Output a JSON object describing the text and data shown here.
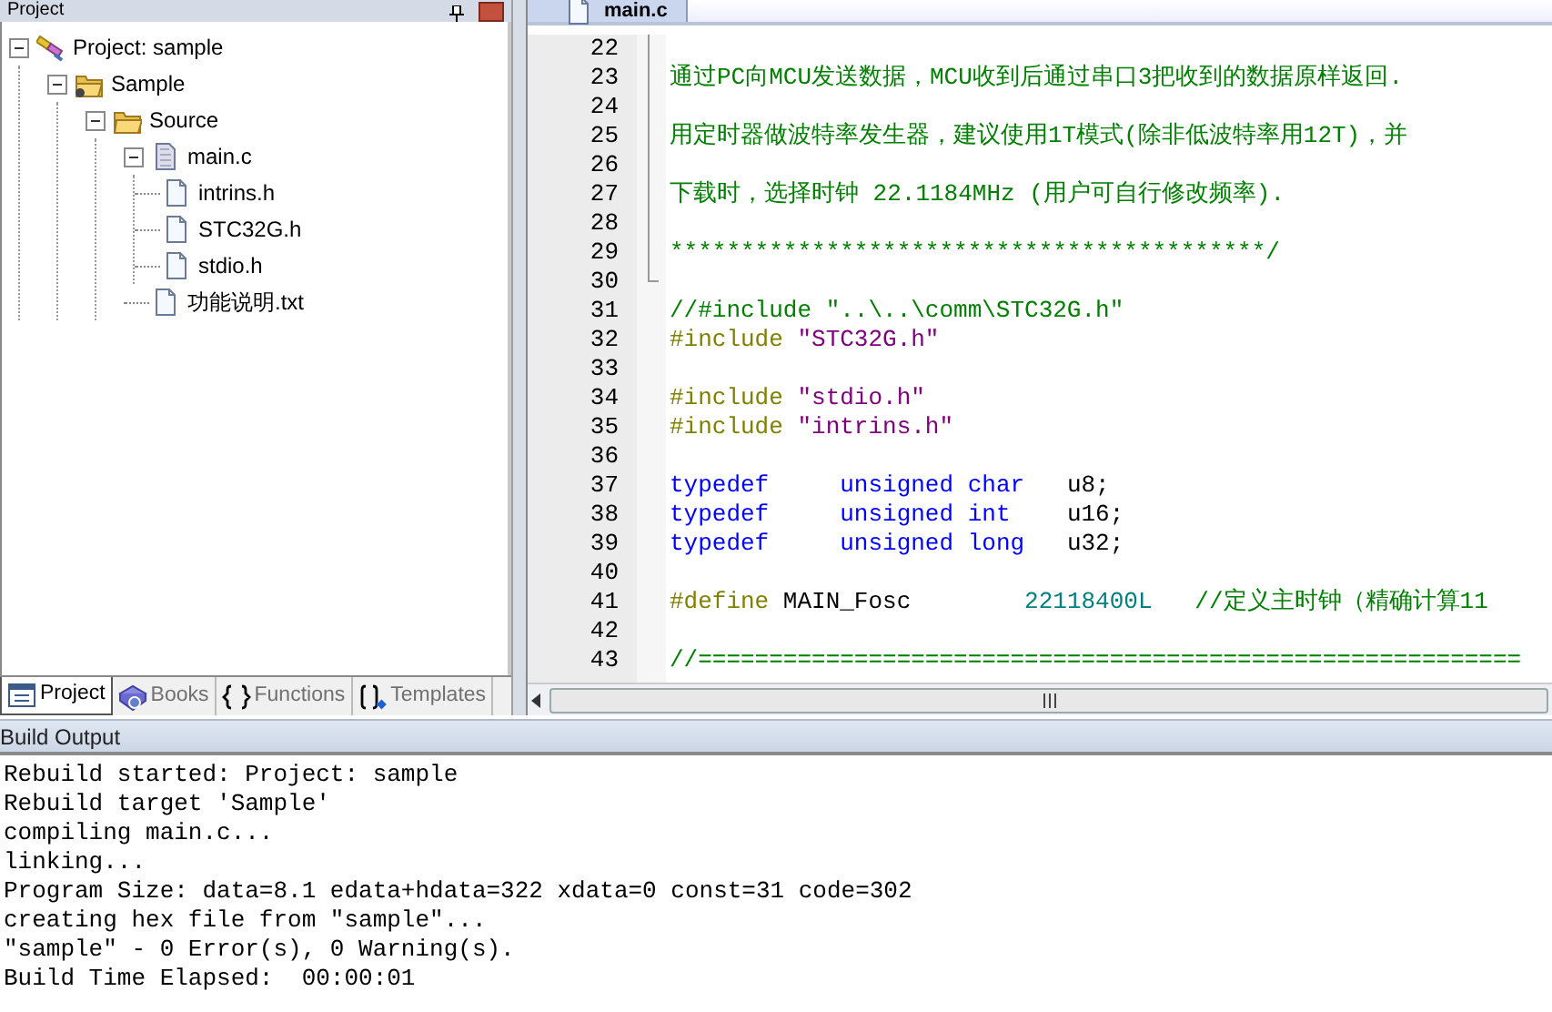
{
  "project_panel": {
    "title": "Project",
    "tree": [
      {
        "label": "Project: sample",
        "kind": "project",
        "expanded": true,
        "children": [
          {
            "label": "Sample",
            "kind": "target",
            "expanded": true,
            "children": [
              {
                "label": "Source",
                "kind": "folder",
                "expanded": true,
                "children": [
                  {
                    "label": "main.c",
                    "kind": "source",
                    "expanded": true,
                    "children": [
                      {
                        "label": "intrins.h",
                        "kind": "file"
                      },
                      {
                        "label": "STC32G.h",
                        "kind": "file"
                      },
                      {
                        "label": "stdio.h",
                        "kind": "file"
                      }
                    ]
                  },
                  {
                    "label": "功能说明.txt",
                    "kind": "file"
                  }
                ]
              }
            ]
          }
        ]
      }
    ],
    "tabs": [
      {
        "label": "Project",
        "kind": "project",
        "selected": true
      },
      {
        "label": "Books",
        "kind": "books",
        "selected": false
      },
      {
        "label": "Functions",
        "kind": "functions",
        "selected": false
      },
      {
        "label": "Templates",
        "kind": "templates",
        "selected": false
      }
    ]
  },
  "editor": {
    "tabs": [
      {
        "label": "main.c",
        "selected": true
      }
    ],
    "lines": [
      {
        "number": "22"
      },
      {
        "number": "23",
        "tokens": [
          {
            "text": "通过PC向MCU发送数据，MCU收到后通过串口3把收到的数据原样返回.",
            "kind": "comment"
          }
        ]
      },
      {
        "number": "24"
      },
      {
        "number": "25",
        "tokens": [
          {
            "text": "用定时器做波特率发生器，建议使用1T模式(除非低波特率用12T)，并",
            "kind": "comment"
          }
        ]
      },
      {
        "number": "26"
      },
      {
        "number": "27",
        "tokens": [
          {
            "text": "下载时，选择时钟 22.1184MHz (用户可自行修改频率).",
            "kind": "comment"
          }
        ]
      },
      {
        "number": "28"
      },
      {
        "number": "29",
        "tokens": [
          {
            "text": "******************************************/",
            "kind": "comment"
          }
        ]
      },
      {
        "number": "30"
      },
      {
        "number": "31",
        "tokens": [
          {
            "text": "//#include \"..\\..\\comm\\STC32G.h\"",
            "kind": "comment"
          }
        ]
      },
      {
        "number": "32",
        "tokens": [
          {
            "text": "#include ",
            "kind": "preproc"
          },
          {
            "text": "\"STC32G.h\"",
            "kind": "string"
          }
        ]
      },
      {
        "number": "33"
      },
      {
        "number": "34",
        "tokens": [
          {
            "text": "#include ",
            "kind": "preproc"
          },
          {
            "text": "\"stdio.h\"",
            "kind": "string"
          }
        ]
      },
      {
        "number": "35",
        "tokens": [
          {
            "text": "#include ",
            "kind": "preproc"
          },
          {
            "text": "\"intrins.h\"",
            "kind": "string"
          }
        ]
      },
      {
        "number": "36"
      },
      {
        "number": "37",
        "tokens": [
          {
            "text": "typedef     ",
            "kind": "keyword"
          },
          {
            "text": "unsigned char",
            "kind": "keyword"
          },
          {
            "text": "   u8;",
            "kind": "plain"
          }
        ]
      },
      {
        "number": "38",
        "tokens": [
          {
            "text": "typedef     ",
            "kind": "keyword"
          },
          {
            "text": "unsigned int",
            "kind": "keyword"
          },
          {
            "text": "    u16;",
            "kind": "plain"
          }
        ]
      },
      {
        "number": "39",
        "tokens": [
          {
            "text": "typedef     ",
            "kind": "keyword"
          },
          {
            "text": "unsigned long",
            "kind": "keyword"
          },
          {
            "text": "   u32;",
            "kind": "plain"
          }
        ]
      },
      {
        "number": "40"
      },
      {
        "number": "41",
        "tokens": [
          {
            "text": "#define",
            "kind": "preproc"
          },
          {
            "text": " MAIN_Fosc        ",
            "kind": "plain"
          },
          {
            "text": "22118400L",
            "kind": "number"
          },
          {
            "text": "   //定义主时钟（精确计算11",
            "kind": "comment"
          }
        ]
      },
      {
        "number": "42"
      },
      {
        "number": "43",
        "tokens": [
          {
            "text": "//==========================================================",
            "kind": "comment"
          }
        ]
      }
    ]
  },
  "build_output": {
    "title": "Build Output",
    "lines": [
      "Rebuild started: Project: sample",
      "Rebuild target 'Sample'",
      "compiling main.c...",
      "linking...",
      "Program Size: data=8.1 edata+hdata=322 xdata=0 const=31 code=302",
      "creating hex file from \"sample\"...",
      "\"sample\" - 0 Error(s), 0 Warning(s).",
      "Build Time Elapsed:  00:00:01"
    ]
  }
}
